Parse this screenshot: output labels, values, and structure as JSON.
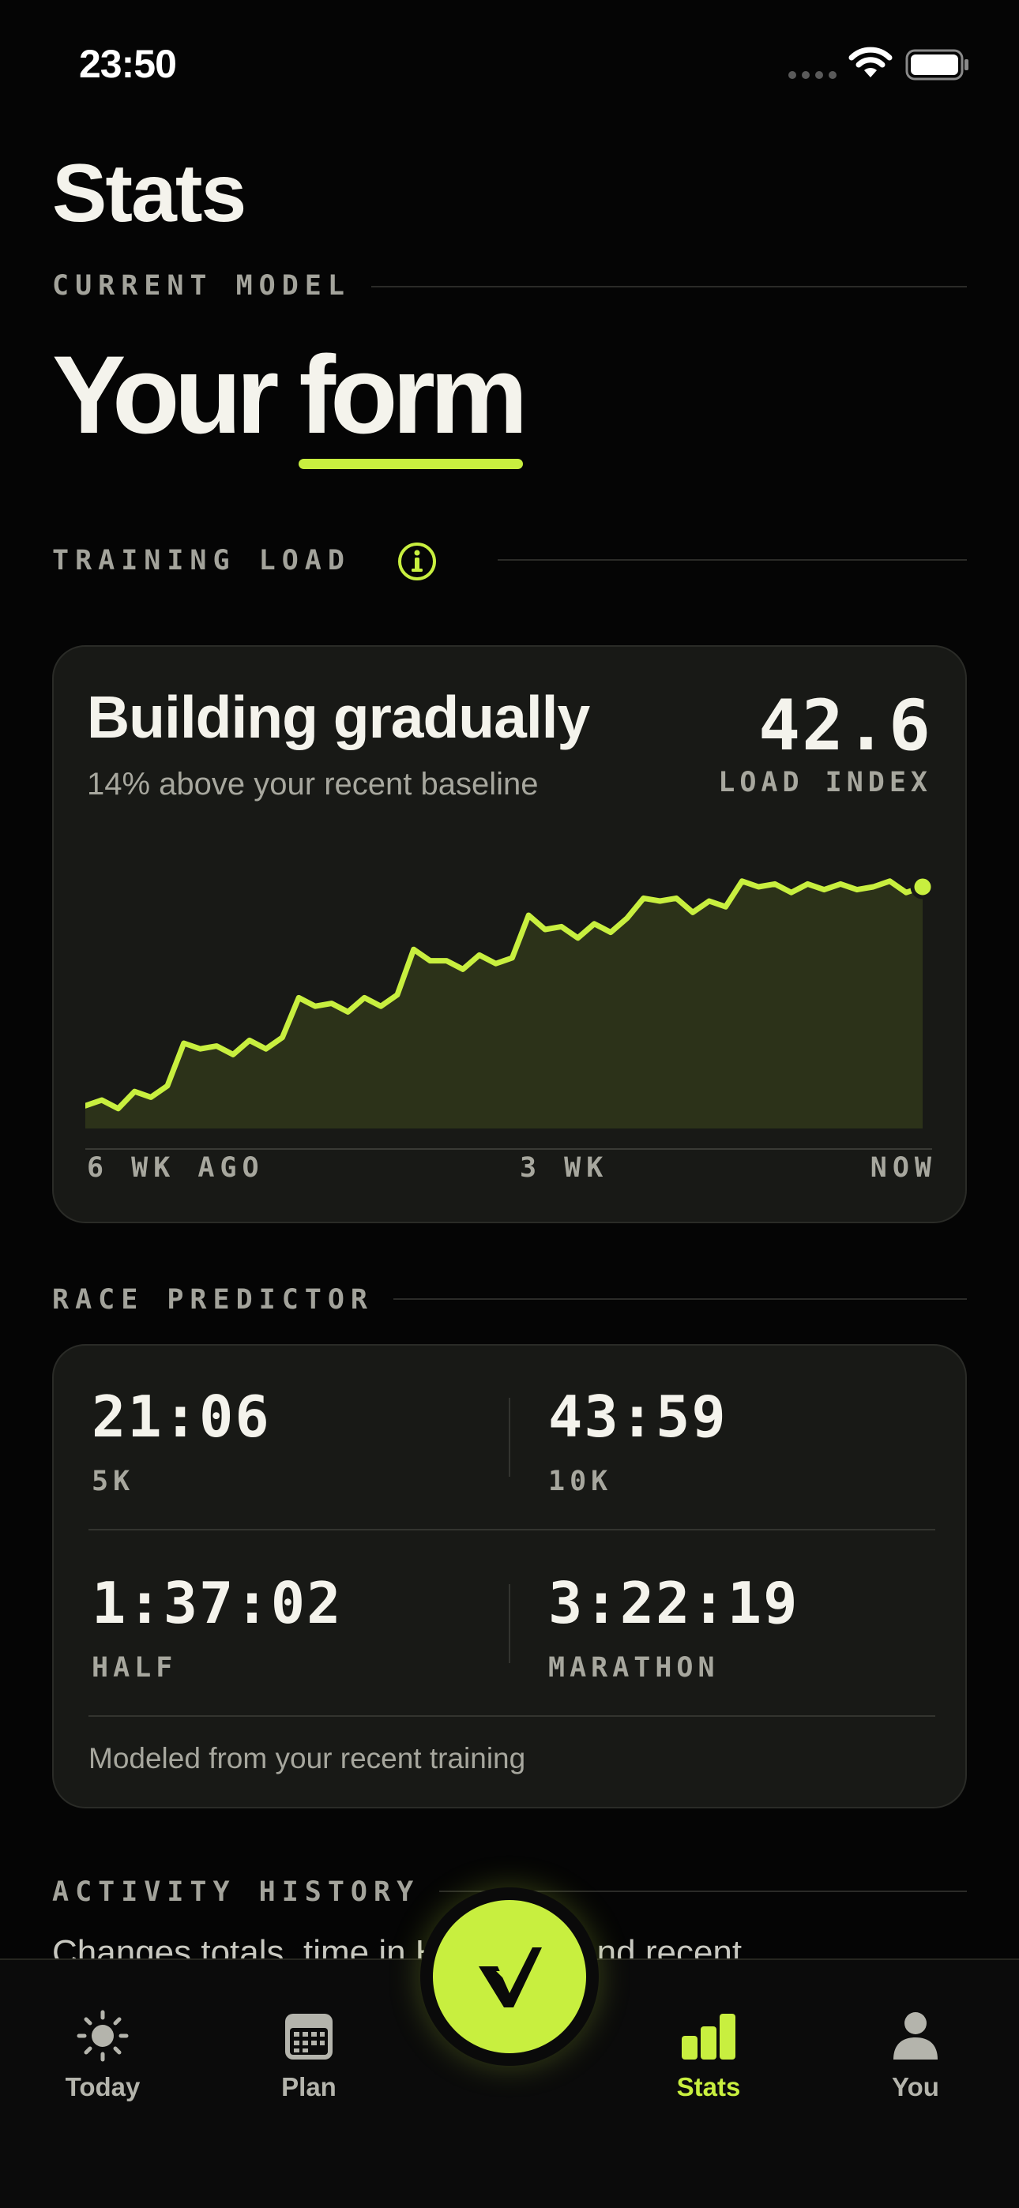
{
  "status_bar": {
    "time": "23:50"
  },
  "page": {
    "title": "Stats"
  },
  "current_model": {
    "label": "CURRENT MODEL",
    "hero_text": "Your",
    "hero_highlight": "form"
  },
  "training_load": {
    "label": "TRAINING LOAD",
    "headline": "Building gradually",
    "subtitle": "14% above your recent baseline",
    "value": "42.6",
    "unit": "LOAD INDEX",
    "accent_color": "#c8ef3f",
    "chart_data": {
      "type": "area",
      "xlabels": [
        "6 WK AGO",
        "3 WK",
        "NOW"
      ],
      "values": [
        8,
        10,
        7,
        13,
        11,
        15,
        30,
        28,
        29,
        26,
        31,
        28,
        32,
        46,
        43,
        44,
        41,
        46,
        43,
        47,
        63,
        59,
        59,
        56,
        61,
        58,
        60,
        75,
        70,
        71,
        67,
        72,
        69,
        74,
        81,
        80,
        81,
        76,
        80,
        78,
        87,
        85,
        86,
        83,
        86,
        84,
        86,
        84,
        85,
        87,
        83,
        85
      ],
      "ylim": [
        0,
        100
      ],
      "last_point_highlight": true
    }
  },
  "race_predictor": {
    "label": "RACE PREDICTOR",
    "entries": [
      {
        "time": "21:06",
        "distance": "5K"
      },
      {
        "time": "43:59",
        "distance": "10K"
      },
      {
        "time": "1:37:02",
        "distance": "HALF"
      },
      {
        "time": "3:22:19",
        "distance": "MARATHON"
      }
    ],
    "note": "Modeled from your recent training"
  },
  "activity_history": {
    "label": "ACTIVITY HISTORY",
    "blurb": "Changes totals, time in HR zones and recent"
  },
  "tab_bar": {
    "tabs": [
      {
        "label": "Today",
        "icon": "sun-icon"
      },
      {
        "label": "Plan",
        "icon": "calendar-icon"
      },
      {
        "label": "Stats",
        "icon": "bar-chart-icon",
        "active": true
      },
      {
        "label": "You",
        "icon": "person-icon"
      }
    ],
    "fab_icon": "v-logo-icon"
  }
}
